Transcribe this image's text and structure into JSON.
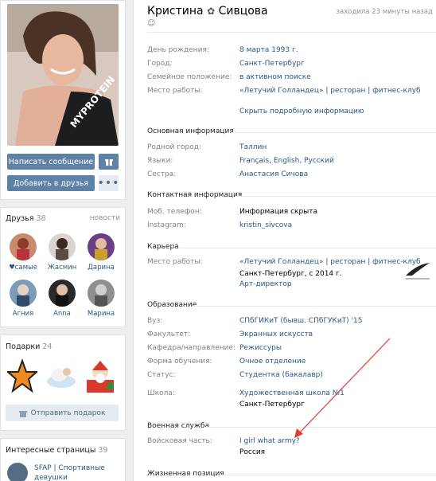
{
  "profile": {
    "name": "Кристина",
    "surname": "Сивцова",
    "name_icon": "flower-icon",
    "last_seen": "заходила 23 минуты назад",
    "smile_icon": "smile-icon"
  },
  "actions": {
    "message": "Написать сообщение",
    "add_friend": "Добавить в друзья",
    "gift_icon": "gift-icon",
    "more_icon": "more-dots-icon"
  },
  "basic": {
    "rows": [
      {
        "label": "День рождения:",
        "value": "8 марта 1993 г."
      },
      {
        "label": "Город:",
        "value": "Санкт-Петербург"
      },
      {
        "label": "Семейное положение:",
        "value": "в активном поиске"
      },
      {
        "label": "Место работы:",
        "value": "«Летучий Голландец» | ресторан | фитнес-клуб"
      }
    ],
    "show_more": "Скрыть подробную информацию"
  },
  "main_info": {
    "title": "Основная информация",
    "rows": [
      {
        "label": "Родной город:",
        "value": "Таллин"
      },
      {
        "label": "Языки:",
        "value": "Français, English, Русский"
      },
      {
        "label": "Сестра:",
        "value": "Анастасия Сичова"
      }
    ]
  },
  "contacts": {
    "title": "Контактная информация",
    "rows": [
      {
        "label": "Моб. телефон:",
        "value": "Информация скрыта"
      },
      {
        "label": "Instagram:",
        "value": "kristin_sivcova"
      }
    ]
  },
  "career": {
    "title": "Карьера",
    "label": "Место работы:",
    "company": "«Летучий Голландец» | ресторан | фитнес-клуб",
    "period": "Санкт-Петербург, с 2014 г.",
    "position": "Арт-директор"
  },
  "education": {
    "title": "Образование",
    "rows": [
      {
        "label": "Вуз:",
        "value": "СПбГИКиТ (бывш. СПбГУКиТ) '15"
      },
      {
        "label": "Факультет:",
        "value": "Экранных искусств"
      },
      {
        "label": "Кафедра/направление:",
        "value": "Режиссуры"
      },
      {
        "label": "Форма обучения:",
        "value": "Очное отделение"
      },
      {
        "label": "Статус:",
        "value": "Студентка (бакалавр)"
      }
    ],
    "school_label": "Школа:",
    "school": "Художественная школа №1",
    "school_city": "Санкт-Петербург"
  },
  "military": {
    "title": "Военная служба",
    "label": "Войсковая часть:",
    "unit": "I girl what army?",
    "country": "Россия"
  },
  "life": {
    "title": "Жизненная позиция"
  },
  "friends": {
    "title": "Друзья",
    "count": "38",
    "news": "новости",
    "list": [
      {
        "name": "♥самые"
      },
      {
        "name": "Жасмин"
      },
      {
        "name": "Дарина"
      },
      {
        "name": "Агния"
      },
      {
        "name": "Anna"
      },
      {
        "name": "Марина"
      }
    ]
  },
  "gifts": {
    "title": "Подарки",
    "count": "24",
    "send": "Отправить подарок",
    "send_icon": "gift-icon"
  },
  "pages": {
    "title": "Интересные страницы",
    "count": "39",
    "item": "SFAP | Спортивные девушки"
  },
  "colors": {
    "button": "#5e81a8",
    "link": "#2a5885",
    "arrow": "#e53b2c"
  }
}
